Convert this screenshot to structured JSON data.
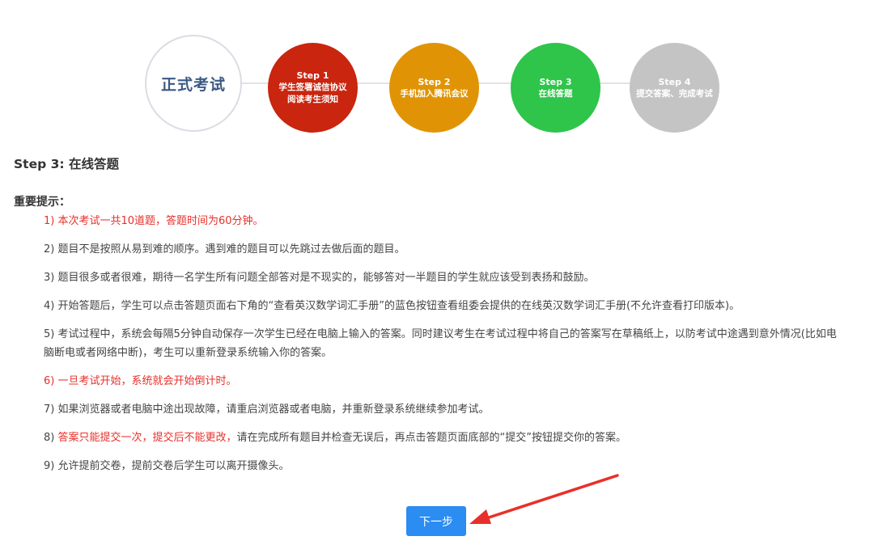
{
  "colors": {
    "step1": "#c9250f",
    "step2": "#e09405",
    "step3": "#2ec54a",
    "step4": "#c4c4c4",
    "accent_red": "#e8302a",
    "button": "#2b8cf2"
  },
  "steps_bar": {
    "main_label": "正式考试",
    "steps": [
      {
        "no": "Step 1",
        "desc": "学生签署诚信协议\n阅读考生须知"
      },
      {
        "no": "Step 2",
        "desc": "手机加入腾讯会议"
      },
      {
        "no": "Step 3",
        "desc": "在线答题"
      },
      {
        "no": "Step 4",
        "desc": "提交答案、完成考试"
      }
    ]
  },
  "content": {
    "heading": "Step 3: 在线答题",
    "notice_title": "重要提示：",
    "items": [
      {
        "text": "1) 本次考试一共10道题，答题时间为60分钟。"
      },
      {
        "text": "2) 题目不是按照从易到难的顺序。遇到难的题目可以先跳过去做后面的题目。"
      },
      {
        "text": "3) 题目很多或者很难，期待一名学生所有问题全部答对是不现实的，能够答对一半题目的学生就应该受到表扬和鼓励。"
      },
      {
        "text": "4) 开始答题后，学生可以点击答题页面右下角的“查看英汉数学词汇手册”的蓝色按钮查看组委会提供的在线英汉数学词汇手册(不允许查看打印版本)。"
      },
      {
        "text": "5) 考试过程中，系统会每隔5分钟自动保存一次学生已经在电脑上输入的答案。同时建议考生在考试过程中将自己的答案写在草稿纸上，以防考试中途遇到意外情况(比如电脑断电或者网络中断)，考生可以重新登录系统输入你的答案。"
      },
      {
        "text": "6) 一旦考试开始，系统就会开始倒计时。"
      },
      {
        "text": "7) 如果浏览器或者电脑中途出现故障，请重启浏览器或者电脑，并重新登录系统继续参加考试。"
      },
      {
        "prefix": "8) ",
        "red": "答案只能提交一次，提交后不能更改，",
        "rest": "请在完成所有题目并检查无误后，再点击答题页面底部的“提交”按钮提交你的答案。"
      },
      {
        "text": "9) 允许提前交卷，提前交卷后学生可以离开摄像头。"
      }
    ]
  },
  "next_button": {
    "label": "下一步"
  }
}
